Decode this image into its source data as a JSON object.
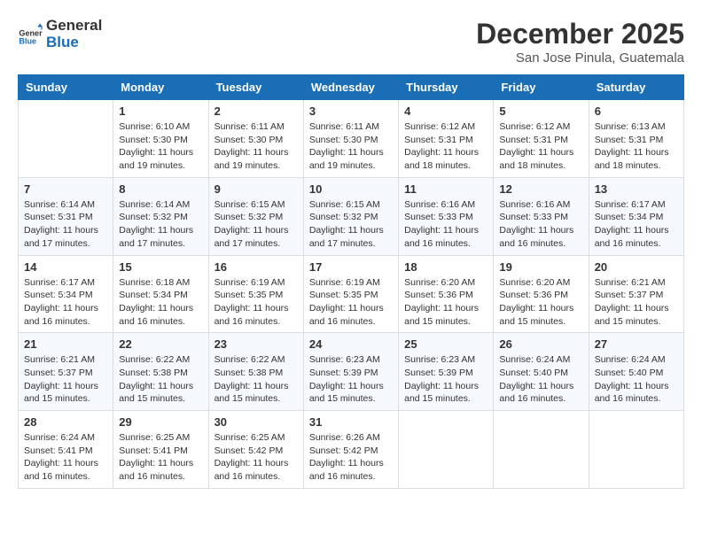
{
  "logo": {
    "general": "General",
    "blue": "Blue"
  },
  "title": "December 2025",
  "location": "San Jose Pinula, Guatemala",
  "days_header": [
    "Sunday",
    "Monday",
    "Tuesday",
    "Wednesday",
    "Thursday",
    "Friday",
    "Saturday"
  ],
  "weeks": [
    [
      {
        "day": "",
        "info": ""
      },
      {
        "day": "1",
        "info": "Sunrise: 6:10 AM\nSunset: 5:30 PM\nDaylight: 11 hours\nand 19 minutes."
      },
      {
        "day": "2",
        "info": "Sunrise: 6:11 AM\nSunset: 5:30 PM\nDaylight: 11 hours\nand 19 minutes."
      },
      {
        "day": "3",
        "info": "Sunrise: 6:11 AM\nSunset: 5:30 PM\nDaylight: 11 hours\nand 19 minutes."
      },
      {
        "day": "4",
        "info": "Sunrise: 6:12 AM\nSunset: 5:31 PM\nDaylight: 11 hours\nand 18 minutes."
      },
      {
        "day": "5",
        "info": "Sunrise: 6:12 AM\nSunset: 5:31 PM\nDaylight: 11 hours\nand 18 minutes."
      },
      {
        "day": "6",
        "info": "Sunrise: 6:13 AM\nSunset: 5:31 PM\nDaylight: 11 hours\nand 18 minutes."
      }
    ],
    [
      {
        "day": "7",
        "info": ""
      },
      {
        "day": "8",
        "info": "Sunrise: 6:14 AM\nSunset: 5:32 PM\nDaylight: 11 hours\nand 17 minutes."
      },
      {
        "day": "9",
        "info": "Sunrise: 6:15 AM\nSunset: 5:32 PM\nDaylight: 11 hours\nand 17 minutes."
      },
      {
        "day": "10",
        "info": "Sunrise: 6:15 AM\nSunset: 5:32 PM\nDaylight: 11 hours\nand 17 minutes."
      },
      {
        "day": "11",
        "info": "Sunrise: 6:16 AM\nSunset: 5:33 PM\nDaylight: 11 hours\nand 16 minutes."
      },
      {
        "day": "12",
        "info": "Sunrise: 6:16 AM\nSunset: 5:33 PM\nDaylight: 11 hours\nand 16 minutes."
      },
      {
        "day": "13",
        "info": "Sunrise: 6:17 AM\nSunset: 5:34 PM\nDaylight: 11 hours\nand 16 minutes."
      }
    ],
    [
      {
        "day": "14",
        "info": ""
      },
      {
        "day": "15",
        "info": "Sunrise: 6:18 AM\nSunset: 5:34 PM\nDaylight: 11 hours\nand 16 minutes."
      },
      {
        "day": "16",
        "info": "Sunrise: 6:19 AM\nSunset: 5:35 PM\nDaylight: 11 hours\nand 16 minutes."
      },
      {
        "day": "17",
        "info": "Sunrise: 6:19 AM\nSunset: 5:35 PM\nDaylight: 11 hours\nand 16 minutes."
      },
      {
        "day": "18",
        "info": "Sunrise: 6:20 AM\nSunset: 5:36 PM\nDaylight: 11 hours\nand 15 minutes."
      },
      {
        "day": "19",
        "info": "Sunrise: 6:20 AM\nSunset: 5:36 PM\nDaylight: 11 hours\nand 15 minutes."
      },
      {
        "day": "20",
        "info": "Sunrise: 6:21 AM\nSunset: 5:37 PM\nDaylight: 11 hours\nand 15 minutes."
      }
    ],
    [
      {
        "day": "21",
        "info": ""
      },
      {
        "day": "22",
        "info": "Sunrise: 6:22 AM\nSunset: 5:38 PM\nDaylight: 11 hours\nand 15 minutes."
      },
      {
        "day": "23",
        "info": "Sunrise: 6:22 AM\nSunset: 5:38 PM\nDaylight: 11 hours\nand 15 minutes."
      },
      {
        "day": "24",
        "info": "Sunrise: 6:23 AM\nSunset: 5:39 PM\nDaylight: 11 hours\nand 15 minutes."
      },
      {
        "day": "25",
        "info": "Sunrise: 6:23 AM\nSunset: 5:39 PM\nDaylight: 11 hours\nand 15 minutes."
      },
      {
        "day": "26",
        "info": "Sunrise: 6:24 AM\nSunset: 5:40 PM\nDaylight: 11 hours\nand 16 minutes."
      },
      {
        "day": "27",
        "info": "Sunrise: 6:24 AM\nSunset: 5:40 PM\nDaylight: 11 hours\nand 16 minutes."
      }
    ],
    [
      {
        "day": "28",
        "info": "Sunrise: 6:24 AM\nSunset: 5:41 PM\nDaylight: 11 hours\nand 16 minutes."
      },
      {
        "day": "29",
        "info": "Sunrise: 6:25 AM\nSunset: 5:41 PM\nDaylight: 11 hours\nand 16 minutes."
      },
      {
        "day": "30",
        "info": "Sunrise: 6:25 AM\nSunset: 5:42 PM\nDaylight: 11 hours\nand 16 minutes."
      },
      {
        "day": "31",
        "info": "Sunrise: 6:26 AM\nSunset: 5:42 PM\nDaylight: 11 hours\nand 16 minutes."
      },
      {
        "day": "",
        "info": ""
      },
      {
        "day": "",
        "info": ""
      },
      {
        "day": "",
        "info": ""
      }
    ]
  ],
  "week7_sunday": {
    "day": "7",
    "info": "Sunrise: 6:14 AM\nSunset: 5:31 PM\nDaylight: 11 hours\nand 17 minutes."
  },
  "week14_sunday": {
    "day": "14",
    "info": "Sunrise: 6:17 AM\nSunset: 5:34 PM\nDaylight: 11 hours\nand 16 minutes."
  },
  "week21_sunday": {
    "day": "21",
    "info": "Sunrise: 6:21 AM\nSunset: 5:37 PM\nDaylight: 11 hours\nand 15 minutes."
  }
}
